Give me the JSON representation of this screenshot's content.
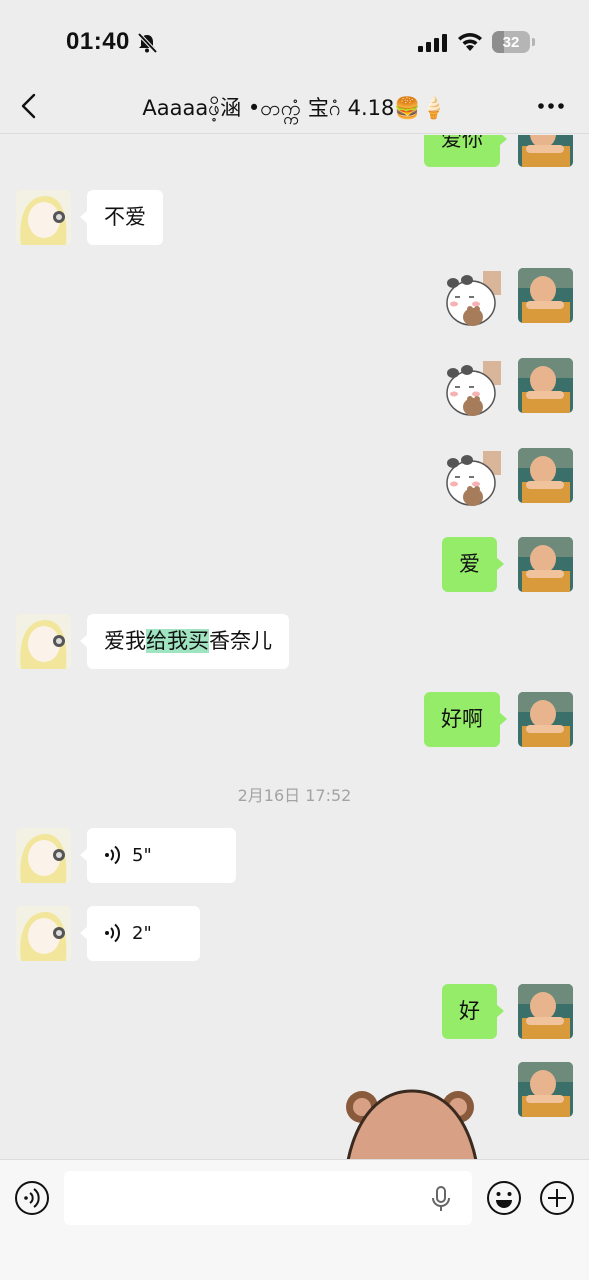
{
  "status_bar": {
    "time": "01:40",
    "battery": "32",
    "battery_level": 0.32
  },
  "nav": {
    "title": "Aaaaaဖိ့涵 •တက္ကံ 宝ဂံ 4.18🍔🍦"
  },
  "messages": [
    {
      "side": "right",
      "type": "text",
      "text": "爱你"
    },
    {
      "side": "left",
      "type": "text",
      "text": "不爱"
    },
    {
      "side": "right",
      "type": "sticker",
      "sticker": "panda-cat-sticker"
    },
    {
      "side": "right",
      "type": "sticker",
      "sticker": "panda-cat-sticker"
    },
    {
      "side": "right",
      "type": "sticker",
      "sticker": "panda-cat-sticker"
    },
    {
      "side": "right",
      "type": "text",
      "text": "爱"
    },
    {
      "side": "left",
      "type": "text",
      "text_before": "爱我",
      "text_highlight": "给我买",
      "text_after": "香奈儿"
    },
    {
      "side": "right",
      "type": "text",
      "text": "好啊"
    },
    {
      "type": "timestamp",
      "text": "2月16日 17:52"
    },
    {
      "side": "left",
      "type": "voice",
      "duration": "5\""
    },
    {
      "side": "left",
      "type": "voice",
      "duration": "2\""
    },
    {
      "side": "right",
      "type": "text",
      "text": "好"
    },
    {
      "side": "right",
      "type": "sticker",
      "sticker": "brown-bear-sticker"
    }
  ],
  "input": {
    "value": "",
    "placeholder": ""
  },
  "icons": {
    "back": "back-icon",
    "more": "more-icon",
    "voice_toggle": "voice-toggle-icon",
    "mic": "mic-icon",
    "emoji": "emoji-icon",
    "plus": "plus-icon"
  },
  "colors": {
    "outgoing_bubble": "#95ec69",
    "incoming_bubble": "#ffffff",
    "background": "#ededed",
    "highlight": "#9fe3c0"
  }
}
